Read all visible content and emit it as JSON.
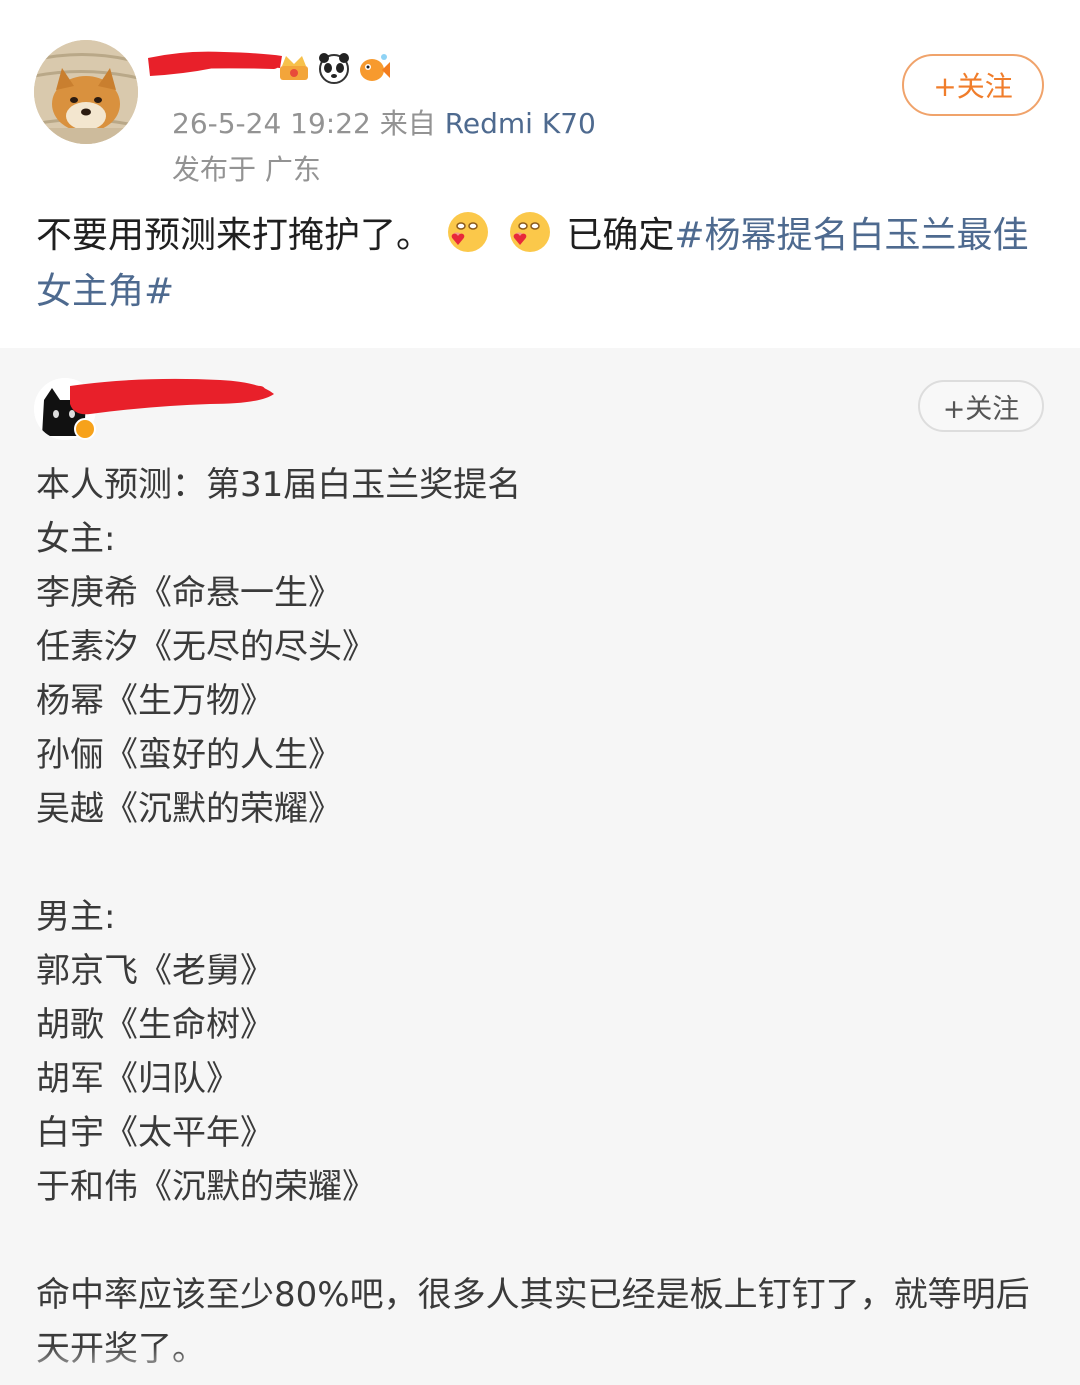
{
  "post": {
    "date": "26-5-24 19:22",
    "source_prefix": "来自",
    "device": "Redmi K70",
    "location": "发布于 广东",
    "follow_label": "+关注",
    "text_before": "不要用预测来打掩护了。",
    "text_mid": "已确定",
    "topic": "#杨幂提名白玉兰最佳女主角#",
    "emoji": [
      "shy-heart-emoji",
      "shy-heart-emoji"
    ],
    "badges": [
      "crown-icon",
      "panda-icon",
      "fish-icon"
    ]
  },
  "quote": {
    "follow_label": "+关注",
    "heading": "本人预测：第31届白玉兰奖提名",
    "actress_label": "女主:",
    "actresses": [
      "李庚希《命悬一生》",
      "任素汐《无尽的尽头》",
      "杨幂《生万物》",
      "孙俪《蛮好的人生》",
      "吴越《沉默的荣耀》"
    ],
    "actor_label": "男主:",
    "actors": [
      "郭京飞《老舅》",
      "胡歌《生命树》",
      "胡军《归队》",
      "白宇《太平年》",
      "于和伟《沉默的荣耀》"
    ],
    "closing": "命中率应该至少80%吧，很多人其实已经是板上钉钉了，就等明后天开奖了。"
  },
  "colors": {
    "topic_blue": "#4e6a8f",
    "follow_orange": "#f07d2b",
    "redact_red": "#e8202a",
    "quote_bg": "#f6f6f6"
  }
}
